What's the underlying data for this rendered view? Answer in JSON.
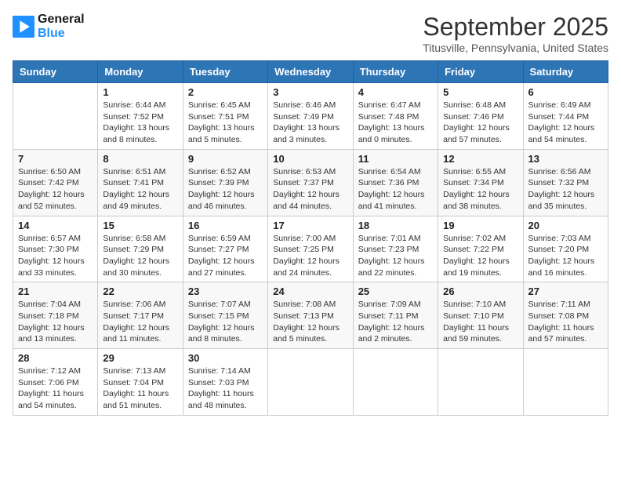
{
  "header": {
    "logo_line1": "General",
    "logo_line2": "Blue",
    "month": "September 2025",
    "location": "Titusville, Pennsylvania, United States"
  },
  "days_of_week": [
    "Sunday",
    "Monday",
    "Tuesday",
    "Wednesday",
    "Thursday",
    "Friday",
    "Saturday"
  ],
  "weeks": [
    [
      {
        "day": "",
        "sunrise": "",
        "sunset": "",
        "daylight": ""
      },
      {
        "day": "1",
        "sunrise": "Sunrise: 6:44 AM",
        "sunset": "Sunset: 7:52 PM",
        "daylight": "Daylight: 13 hours and 8 minutes."
      },
      {
        "day": "2",
        "sunrise": "Sunrise: 6:45 AM",
        "sunset": "Sunset: 7:51 PM",
        "daylight": "Daylight: 13 hours and 5 minutes."
      },
      {
        "day": "3",
        "sunrise": "Sunrise: 6:46 AM",
        "sunset": "Sunset: 7:49 PM",
        "daylight": "Daylight: 13 hours and 3 minutes."
      },
      {
        "day": "4",
        "sunrise": "Sunrise: 6:47 AM",
        "sunset": "Sunset: 7:48 PM",
        "daylight": "Daylight: 13 hours and 0 minutes."
      },
      {
        "day": "5",
        "sunrise": "Sunrise: 6:48 AM",
        "sunset": "Sunset: 7:46 PM",
        "daylight": "Daylight: 12 hours and 57 minutes."
      },
      {
        "day": "6",
        "sunrise": "Sunrise: 6:49 AM",
        "sunset": "Sunset: 7:44 PM",
        "daylight": "Daylight: 12 hours and 54 minutes."
      }
    ],
    [
      {
        "day": "7",
        "sunrise": "Sunrise: 6:50 AM",
        "sunset": "Sunset: 7:42 PM",
        "daylight": "Daylight: 12 hours and 52 minutes."
      },
      {
        "day": "8",
        "sunrise": "Sunrise: 6:51 AM",
        "sunset": "Sunset: 7:41 PM",
        "daylight": "Daylight: 12 hours and 49 minutes."
      },
      {
        "day": "9",
        "sunrise": "Sunrise: 6:52 AM",
        "sunset": "Sunset: 7:39 PM",
        "daylight": "Daylight: 12 hours and 46 minutes."
      },
      {
        "day": "10",
        "sunrise": "Sunrise: 6:53 AM",
        "sunset": "Sunset: 7:37 PM",
        "daylight": "Daylight: 12 hours and 44 minutes."
      },
      {
        "day": "11",
        "sunrise": "Sunrise: 6:54 AM",
        "sunset": "Sunset: 7:36 PM",
        "daylight": "Daylight: 12 hours and 41 minutes."
      },
      {
        "day": "12",
        "sunrise": "Sunrise: 6:55 AM",
        "sunset": "Sunset: 7:34 PM",
        "daylight": "Daylight: 12 hours and 38 minutes."
      },
      {
        "day": "13",
        "sunrise": "Sunrise: 6:56 AM",
        "sunset": "Sunset: 7:32 PM",
        "daylight": "Daylight: 12 hours and 35 minutes."
      }
    ],
    [
      {
        "day": "14",
        "sunrise": "Sunrise: 6:57 AM",
        "sunset": "Sunset: 7:30 PM",
        "daylight": "Daylight: 12 hours and 33 minutes."
      },
      {
        "day": "15",
        "sunrise": "Sunrise: 6:58 AM",
        "sunset": "Sunset: 7:29 PM",
        "daylight": "Daylight: 12 hours and 30 minutes."
      },
      {
        "day": "16",
        "sunrise": "Sunrise: 6:59 AM",
        "sunset": "Sunset: 7:27 PM",
        "daylight": "Daylight: 12 hours and 27 minutes."
      },
      {
        "day": "17",
        "sunrise": "Sunrise: 7:00 AM",
        "sunset": "Sunset: 7:25 PM",
        "daylight": "Daylight: 12 hours and 24 minutes."
      },
      {
        "day": "18",
        "sunrise": "Sunrise: 7:01 AM",
        "sunset": "Sunset: 7:23 PM",
        "daylight": "Daylight: 12 hours and 22 minutes."
      },
      {
        "day": "19",
        "sunrise": "Sunrise: 7:02 AM",
        "sunset": "Sunset: 7:22 PM",
        "daylight": "Daylight: 12 hours and 19 minutes."
      },
      {
        "day": "20",
        "sunrise": "Sunrise: 7:03 AM",
        "sunset": "Sunset: 7:20 PM",
        "daylight": "Daylight: 12 hours and 16 minutes."
      }
    ],
    [
      {
        "day": "21",
        "sunrise": "Sunrise: 7:04 AM",
        "sunset": "Sunset: 7:18 PM",
        "daylight": "Daylight: 12 hours and 13 minutes."
      },
      {
        "day": "22",
        "sunrise": "Sunrise: 7:06 AM",
        "sunset": "Sunset: 7:17 PM",
        "daylight": "Daylight: 12 hours and 11 minutes."
      },
      {
        "day": "23",
        "sunrise": "Sunrise: 7:07 AM",
        "sunset": "Sunset: 7:15 PM",
        "daylight": "Daylight: 12 hours and 8 minutes."
      },
      {
        "day": "24",
        "sunrise": "Sunrise: 7:08 AM",
        "sunset": "Sunset: 7:13 PM",
        "daylight": "Daylight: 12 hours and 5 minutes."
      },
      {
        "day": "25",
        "sunrise": "Sunrise: 7:09 AM",
        "sunset": "Sunset: 7:11 PM",
        "daylight": "Daylight: 12 hours and 2 minutes."
      },
      {
        "day": "26",
        "sunrise": "Sunrise: 7:10 AM",
        "sunset": "Sunset: 7:10 PM",
        "daylight": "Daylight: 11 hours and 59 minutes."
      },
      {
        "day": "27",
        "sunrise": "Sunrise: 7:11 AM",
        "sunset": "Sunset: 7:08 PM",
        "daylight": "Daylight: 11 hours and 57 minutes."
      }
    ],
    [
      {
        "day": "28",
        "sunrise": "Sunrise: 7:12 AM",
        "sunset": "Sunset: 7:06 PM",
        "daylight": "Daylight: 11 hours and 54 minutes."
      },
      {
        "day": "29",
        "sunrise": "Sunrise: 7:13 AM",
        "sunset": "Sunset: 7:04 PM",
        "daylight": "Daylight: 11 hours and 51 minutes."
      },
      {
        "day": "30",
        "sunrise": "Sunrise: 7:14 AM",
        "sunset": "Sunset: 7:03 PM",
        "daylight": "Daylight: 11 hours and 48 minutes."
      },
      {
        "day": "",
        "sunrise": "",
        "sunset": "",
        "daylight": ""
      },
      {
        "day": "",
        "sunrise": "",
        "sunset": "",
        "daylight": ""
      },
      {
        "day": "",
        "sunrise": "",
        "sunset": "",
        "daylight": ""
      },
      {
        "day": "",
        "sunrise": "",
        "sunset": "",
        "daylight": ""
      }
    ]
  ]
}
